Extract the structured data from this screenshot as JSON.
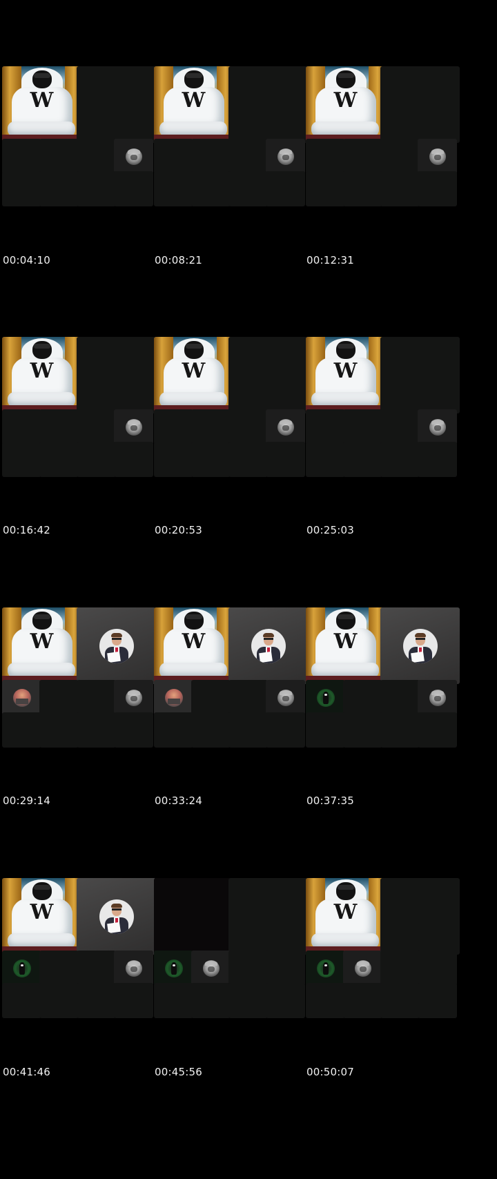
{
  "frames": [
    {
      "timestamp": "00:04:10",
      "tiles": [
        {
          "slot": "big-left",
          "kind": "throne",
          "label": "W"
        },
        {
          "slot": "big-right",
          "kind": "empty"
        },
        {
          "slot": "s1",
          "kind": "empty"
        },
        {
          "slot": "s2",
          "kind": "empty"
        },
        {
          "slot": "s3",
          "kind": "empty"
        },
        {
          "slot": "s4",
          "kind": "wolf"
        },
        {
          "slot": "s5",
          "kind": "empty"
        },
        {
          "slot": "s6",
          "kind": "empty"
        },
        {
          "slot": "s7",
          "kind": "empty"
        },
        {
          "slot": "s8",
          "kind": "empty"
        }
      ]
    },
    {
      "timestamp": "00:08:21",
      "tiles": [
        {
          "slot": "big-left",
          "kind": "throne",
          "label": "W"
        },
        {
          "slot": "big-right",
          "kind": "empty"
        },
        {
          "slot": "s1",
          "kind": "empty"
        },
        {
          "slot": "s2",
          "kind": "empty"
        },
        {
          "slot": "s3",
          "kind": "empty"
        },
        {
          "slot": "s4",
          "kind": "wolf"
        },
        {
          "slot": "s5",
          "kind": "empty"
        },
        {
          "slot": "s6",
          "kind": "empty"
        },
        {
          "slot": "s7",
          "kind": "empty"
        },
        {
          "slot": "s8",
          "kind": "empty"
        }
      ]
    },
    {
      "timestamp": "00:12:31",
      "tiles": [
        {
          "slot": "big-left",
          "kind": "throne",
          "label": "W"
        },
        {
          "slot": "big-right",
          "kind": "empty"
        },
        {
          "slot": "s1",
          "kind": "empty"
        },
        {
          "slot": "s2",
          "kind": "empty"
        },
        {
          "slot": "s3",
          "kind": "empty"
        },
        {
          "slot": "s4",
          "kind": "wolf"
        },
        {
          "slot": "s5",
          "kind": "empty"
        },
        {
          "slot": "s6",
          "kind": "empty"
        },
        {
          "slot": "s7",
          "kind": "empty"
        },
        {
          "slot": "s8",
          "kind": "empty"
        }
      ]
    },
    {
      "timestamp": "00:16:42",
      "tiles": [
        {
          "slot": "big-left",
          "kind": "throne",
          "label": "W"
        },
        {
          "slot": "big-right",
          "kind": "empty"
        },
        {
          "slot": "s1",
          "kind": "empty"
        },
        {
          "slot": "s2",
          "kind": "empty"
        },
        {
          "slot": "s3",
          "kind": "empty"
        },
        {
          "slot": "s4",
          "kind": "wolf"
        },
        {
          "slot": "s5",
          "kind": "empty"
        },
        {
          "slot": "s6",
          "kind": "empty"
        },
        {
          "slot": "s7",
          "kind": "empty"
        },
        {
          "slot": "s8",
          "kind": "empty"
        }
      ]
    },
    {
      "timestamp": "00:20:53",
      "tiles": [
        {
          "slot": "big-left",
          "kind": "throne",
          "label": "W"
        },
        {
          "slot": "big-right",
          "kind": "empty"
        },
        {
          "slot": "s1",
          "kind": "empty"
        },
        {
          "slot": "s2",
          "kind": "empty"
        },
        {
          "slot": "s3",
          "kind": "empty"
        },
        {
          "slot": "s4",
          "kind": "wolf"
        },
        {
          "slot": "s5",
          "kind": "empty"
        },
        {
          "slot": "s6",
          "kind": "empty"
        },
        {
          "slot": "s7",
          "kind": "empty"
        },
        {
          "slot": "s8",
          "kind": "empty"
        }
      ]
    },
    {
      "timestamp": "00:25:03",
      "tiles": [
        {
          "slot": "big-left",
          "kind": "throne",
          "label": "W"
        },
        {
          "slot": "big-right",
          "kind": "empty"
        },
        {
          "slot": "s1",
          "kind": "empty"
        },
        {
          "slot": "s2",
          "kind": "empty"
        },
        {
          "slot": "s3",
          "kind": "empty"
        },
        {
          "slot": "s4",
          "kind": "wolf"
        },
        {
          "slot": "s5",
          "kind": "empty"
        },
        {
          "slot": "s6",
          "kind": "empty"
        },
        {
          "slot": "s7",
          "kind": "empty"
        },
        {
          "slot": "s8",
          "kind": "empty"
        }
      ]
    },
    {
      "timestamp": "00:29:14",
      "tiles": [
        {
          "slot": "big-left",
          "kind": "throne",
          "label": "W"
        },
        {
          "slot": "big-right",
          "kind": "person"
        },
        {
          "slot": "s1",
          "kind": "city"
        },
        {
          "slot": "s2",
          "kind": "empty"
        },
        {
          "slot": "s3",
          "kind": "empty"
        },
        {
          "slot": "s4",
          "kind": "wolf"
        },
        {
          "slot": "s5",
          "kind": "empty"
        },
        {
          "slot": "s6",
          "kind": "empty"
        },
        {
          "slot": "s7",
          "kind": "empty"
        },
        {
          "slot": "s8",
          "kind": "empty"
        }
      ]
    },
    {
      "timestamp": "00:33:24",
      "tiles": [
        {
          "slot": "big-left",
          "kind": "throne",
          "label": "W"
        },
        {
          "slot": "big-right",
          "kind": "person"
        },
        {
          "slot": "s1",
          "kind": "city"
        },
        {
          "slot": "s2",
          "kind": "empty"
        },
        {
          "slot": "s3",
          "kind": "empty"
        },
        {
          "slot": "s4",
          "kind": "wolf"
        },
        {
          "slot": "s5",
          "kind": "empty"
        },
        {
          "slot": "s6",
          "kind": "empty"
        },
        {
          "slot": "s7",
          "kind": "empty"
        },
        {
          "slot": "s8",
          "kind": "empty"
        }
      ]
    },
    {
      "timestamp": "00:37:35",
      "tiles": [
        {
          "slot": "big-left",
          "kind": "throne",
          "label": "W"
        },
        {
          "slot": "big-right",
          "kind": "person"
        },
        {
          "slot": "s1",
          "kind": "green"
        },
        {
          "slot": "s2",
          "kind": "empty"
        },
        {
          "slot": "s3",
          "kind": "empty"
        },
        {
          "slot": "s4",
          "kind": "wolf"
        },
        {
          "slot": "s5",
          "kind": "empty"
        },
        {
          "slot": "s6",
          "kind": "empty"
        },
        {
          "slot": "s7",
          "kind": "empty"
        },
        {
          "slot": "s8",
          "kind": "empty"
        }
      ]
    },
    {
      "timestamp": "00:41:46",
      "tiles": [
        {
          "slot": "big-left",
          "kind": "throne",
          "label": "W"
        },
        {
          "slot": "big-right",
          "kind": "person"
        },
        {
          "slot": "s1",
          "kind": "green"
        },
        {
          "slot": "s2",
          "kind": "empty"
        },
        {
          "slot": "s3",
          "kind": "empty"
        },
        {
          "slot": "s4",
          "kind": "wolf"
        },
        {
          "slot": "s5",
          "kind": "empty"
        },
        {
          "slot": "s6",
          "kind": "empty"
        },
        {
          "slot": "s7",
          "kind": "empty"
        },
        {
          "slot": "s8",
          "kind": "empty"
        }
      ]
    },
    {
      "timestamp": "00:45:56",
      "tiles": [
        {
          "slot": "big-left",
          "kind": "black"
        },
        {
          "slot": "big-right",
          "kind": "empty"
        },
        {
          "slot": "s1",
          "kind": "green"
        },
        {
          "slot": "s2",
          "kind": "wolf"
        },
        {
          "slot": "s3",
          "kind": "empty"
        },
        {
          "slot": "s4",
          "kind": "empty"
        },
        {
          "slot": "s5",
          "kind": "empty"
        },
        {
          "slot": "s6",
          "kind": "empty"
        },
        {
          "slot": "s7",
          "kind": "empty"
        },
        {
          "slot": "s8",
          "kind": "empty"
        }
      ]
    },
    {
      "timestamp": "00:50:07",
      "tiles": [
        {
          "slot": "big-left",
          "kind": "throne",
          "label": "W"
        },
        {
          "slot": "big-right",
          "kind": "empty"
        },
        {
          "slot": "s1",
          "kind": "green"
        },
        {
          "slot": "s2",
          "kind": "wolf"
        },
        {
          "slot": "s3",
          "kind": "empty"
        },
        {
          "slot": "s4",
          "kind": "empty"
        },
        {
          "slot": "s5",
          "kind": "empty"
        },
        {
          "slot": "s6",
          "kind": "empty"
        },
        {
          "slot": "s7",
          "kind": "empty"
        },
        {
          "slot": "s8",
          "kind": "empty"
        }
      ]
    }
  ]
}
